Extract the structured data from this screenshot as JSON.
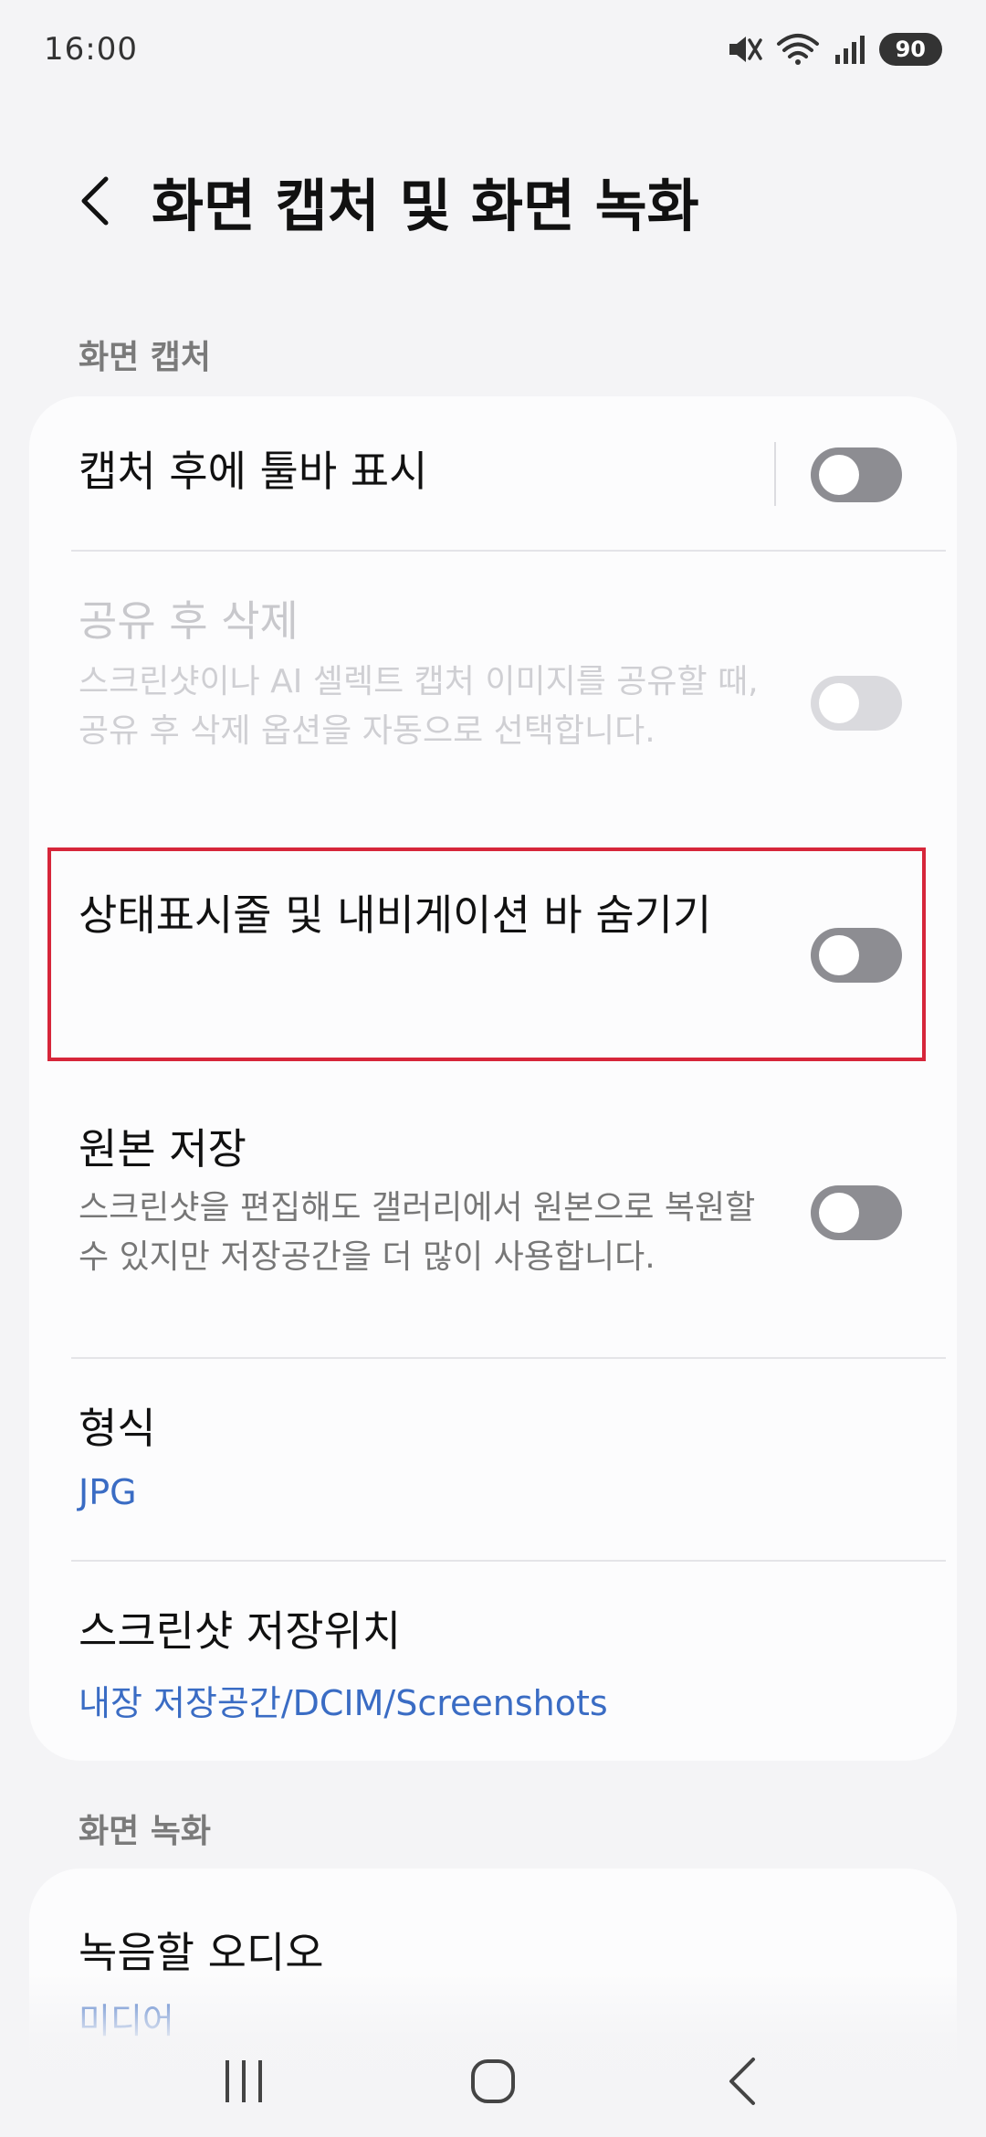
{
  "status_bar": {
    "time": "16:00",
    "battery": "90"
  },
  "header": {
    "title": "화면 캡처 및 화면 녹화"
  },
  "sections": {
    "capture_label": "화면 캡처",
    "recording_label": "화면 녹화"
  },
  "capture_items": {
    "toolbar": {
      "title": "캡처 후에 툴바 표시",
      "enabled": false
    },
    "delete_after_share": {
      "title": "공유 후 삭제",
      "description": "스크린샷이나 AI 셀렉트 캡처 이미지를 공유할 때, 공유 후 삭제 옵션을 자동으로 선택합니다.",
      "enabled": false,
      "disabled": true
    },
    "hide_bars": {
      "title": "상태표시줄 및 내비게이션 바 숨기기",
      "enabled": false
    },
    "save_original": {
      "title": "원본 저장",
      "description": "스크린샷을 편집해도 갤러리에서 원본으로 복원할 수 있지만 저장공간을 더 많이 사용합니다.",
      "enabled": false
    },
    "format": {
      "title": "형식",
      "value": "JPG"
    },
    "location": {
      "title": "스크린샷 저장위치",
      "value": "내장 저장공간/DCIM/Screenshots"
    }
  },
  "recording_items": {
    "audio": {
      "title": "녹음할 오디오",
      "value": "미디어"
    }
  },
  "icons": {
    "back": "chevron-left-icon",
    "mute": "mute-icon",
    "wifi": "wifi-icon",
    "signal": "signal-icon",
    "recents": "recents-icon",
    "home": "home-icon",
    "nav_back": "nav-back-icon"
  },
  "colors": {
    "accent": "#3a6cc4",
    "highlight": "#d6263a",
    "toggle_off": "#8d8d92"
  }
}
